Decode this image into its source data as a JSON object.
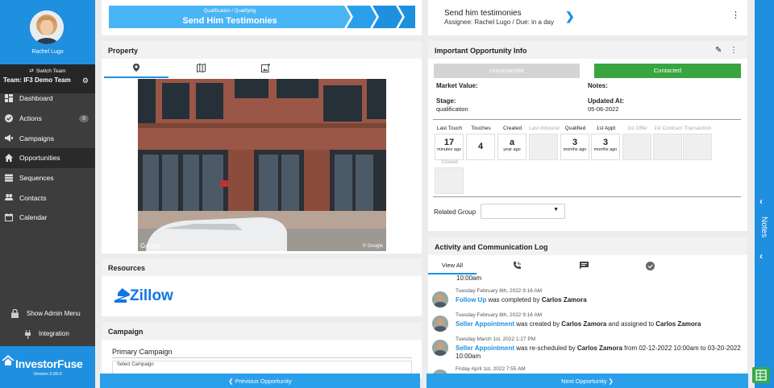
{
  "sidebar": {
    "user_name": "Rachel Lugo",
    "switch_team_label": "Switch Team",
    "team_name": "Team: IF3 Demo Team",
    "items": [
      {
        "label": "Dashboard",
        "icon": "dashboard-icon"
      },
      {
        "label": "Actions",
        "icon": "check-circle-icon",
        "badge": "0"
      },
      {
        "label": "Campaigns",
        "icon": "megaphone-icon"
      },
      {
        "label": "Opportunities",
        "icon": "home-icon"
      },
      {
        "label": "Sequences",
        "icon": "list-icon"
      },
      {
        "label": "Contacts",
        "icon": "people-icon"
      },
      {
        "label": "Calendar",
        "icon": "calendar-icon"
      }
    ],
    "active_item": "Opportunities",
    "admin_label": "Show Admin Menu",
    "integration_label": "Integration",
    "brand_name": "InvestorFuse",
    "version": "Version 3.69.0"
  },
  "stage": {
    "sub": "Qualification / Qualifying",
    "title": "Send Him Testimonies"
  },
  "task": {
    "title": "Send him testimonies",
    "meta": "Assignee: Rachel Lugo / Due: in a day"
  },
  "property": {
    "heading": "Property",
    "tabs": [
      "map-pin-icon",
      "map-icon",
      "add-photo-icon"
    ],
    "photo_credit_left": "Google",
    "photo_credit_right": "© Google"
  },
  "resources": {
    "heading": "Resources",
    "zillow_label": "Zillow"
  },
  "campaign": {
    "heading": "Campaign",
    "primary_label": "Primary Campaign",
    "select_label": "Select Campaign"
  },
  "info": {
    "heading": "Important Opportunity Info",
    "uncontacted_label": "Uncontacted",
    "contacted_label": "Contacted",
    "market_value_label": "Market Value:",
    "notes_label": "Notes:",
    "stage_label": "Stage:",
    "stage_value": "qualification",
    "updated_label": "Updated At:",
    "updated_value": "05-06-2022",
    "stats": [
      {
        "label": "Last Touch",
        "num": "17",
        "unit": "minutes ago"
      },
      {
        "label": "Touches",
        "num": "4",
        "unit": ""
      },
      {
        "label": "Created",
        "num": "a",
        "unit": "year ago"
      },
      {
        "label": "Last Inbound",
        "num": "",
        "unit": ""
      },
      {
        "label": "Qualified",
        "num": "3",
        "unit": "months ago"
      },
      {
        "label": "1st Appt",
        "num": "3",
        "unit": "months ago"
      },
      {
        "label": "1st Offer",
        "num": "",
        "unit": ""
      },
      {
        "label": "1st Contract",
        "num": "",
        "unit": ""
      },
      {
        "label": "Transaction",
        "num": "",
        "unit": ""
      },
      {
        "label": "Closed",
        "num": "",
        "unit": ""
      }
    ],
    "related_group_label": "Related Group"
  },
  "log": {
    "heading": "Activity and Communication Log",
    "tab_view_all": "View All",
    "cut_text": "10:00am",
    "entries": [
      {
        "date": "Tuesday February 8th, 2022 9:16 AM",
        "link": "Follow Up",
        "t1": " was completed by ",
        "b1": "Carlos Zamora",
        "t2": "",
        "b2": "",
        "t3": ""
      },
      {
        "date": "Tuesday February 8th, 2022 9:16 AM",
        "link": "Seller Appointment",
        "t1": " was created by ",
        "b1": "Carlos Zamora",
        "t2": " and assigned to ",
        "b2": "Carlos Zamora",
        "t3": ""
      },
      {
        "date": "Tuesday March 1st, 2022 1:27 PM",
        "link": "Seller Appointment",
        "t1": " was re-scheduled by ",
        "b1": "Carlos Zamora",
        "t2": " from 02-12-2022 10:00am to 03-20-2022 10:00am",
        "b2": "",
        "t3": ""
      },
      {
        "date": "Friday April 1st, 2022 7:55 AM",
        "link": "",
        "t1": "",
        "b1": "",
        "t2": "",
        "b2": "",
        "t3": ""
      }
    ]
  },
  "footer": {
    "prev_label": "❮  Previous Opportunity",
    "next_label": "Next Opportunity  ❯"
  },
  "notes_drawer": {
    "label": "Notes"
  },
  "colors": {
    "brand_blue": "#1f8fe0",
    "contacted_green": "#38a540",
    "sidebar_bg": "#3d3d3d"
  }
}
